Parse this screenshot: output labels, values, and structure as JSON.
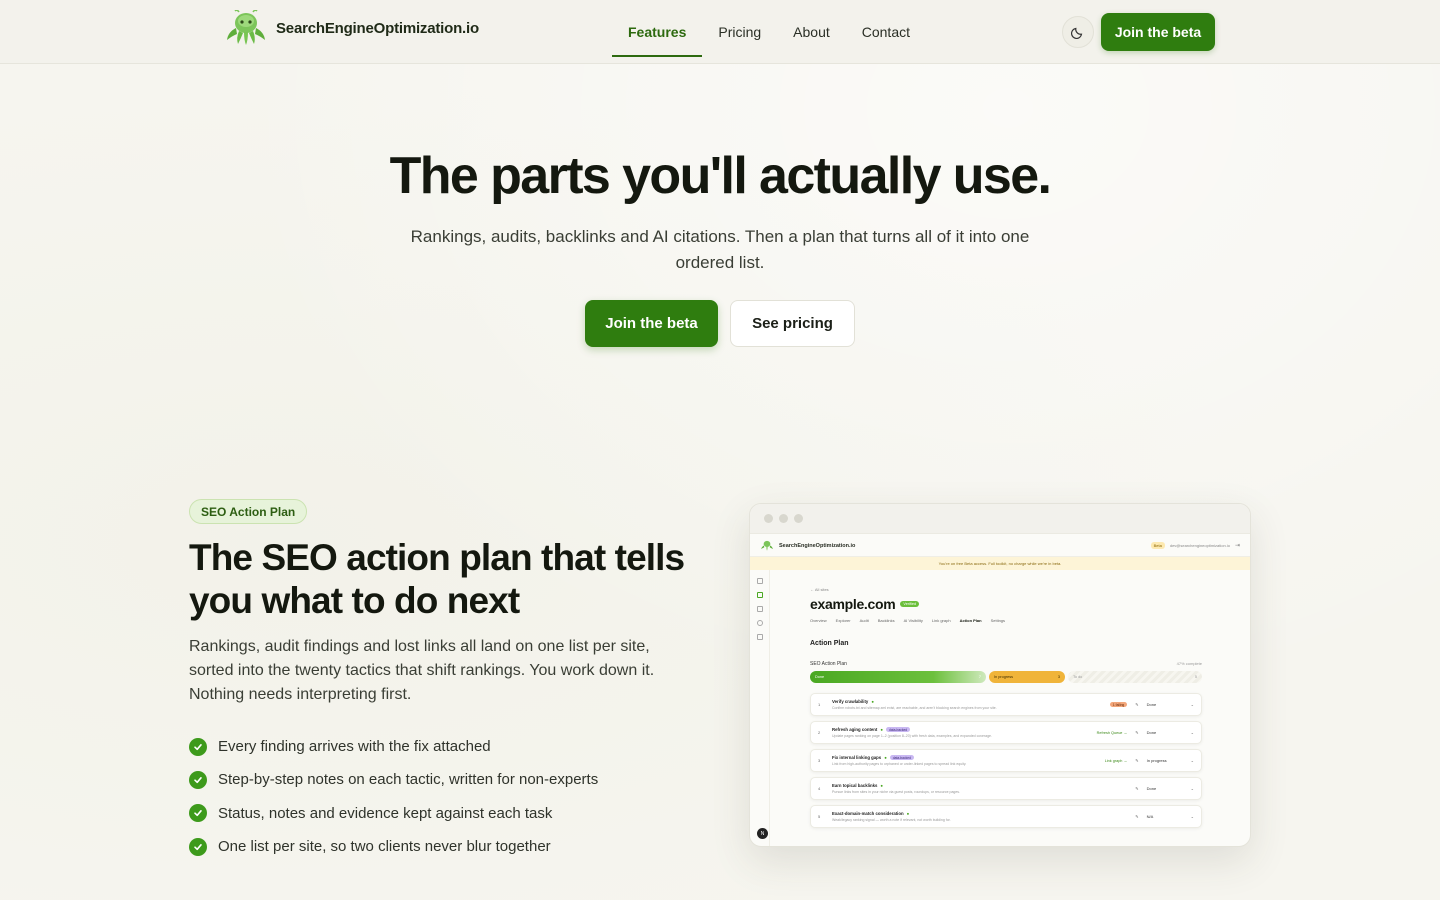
{
  "nav": {
    "brand": "SearchEngineOptimization.io",
    "links": [
      {
        "label": "Features",
        "active": true
      },
      {
        "label": "Pricing",
        "active": false
      },
      {
        "label": "About",
        "active": false
      },
      {
        "label": "Contact",
        "active": false
      }
    ],
    "theme_icon": "moon-icon",
    "cta": "Join the beta"
  },
  "hero": {
    "title": "The parts you'll actually use.",
    "subtitle": "Rankings, audits, backlinks and AI citations. Then a plan that turns all of it into one ordered list.",
    "primary_cta": "Join the beta",
    "secondary_cta": "See pricing"
  },
  "feature": {
    "badge": "SEO Action Plan",
    "title": "The SEO action plan that tells you what to do next",
    "description": "Rankings, audit findings and lost links all land on one list per site, sorted into the twenty tactics that shift rankings. You work down it. Nothing needs interpreting first.",
    "bullets": [
      "Every finding arrives with the fix attached",
      "Step-by-step notes on each tactic, written for non-experts",
      "Status, notes and evidence kept against each task",
      "One list per site, so two clients never blur together"
    ]
  },
  "mockup": {
    "brand": "SearchEngineOptimization.io",
    "beta_tag": "Beta",
    "email": "dev@searchengineoptimization.io",
    "banner": "You're on free Beta access. Full toolkit, no charge while we're in beta.",
    "back_link": "← All sites",
    "domain": "example.com",
    "verified": "Verified",
    "tabs": [
      "Overview",
      "Explorer",
      "Audit",
      "Backlinks",
      "AI Visibility",
      "Link graph",
      "Action Plan",
      "Settings"
    ],
    "active_tab": "Action Plan",
    "section_title": "Action Plan",
    "plan_title": "SEO Action Plan",
    "percent_complete": "47% complete",
    "progress": {
      "done_label": "Done",
      "done_count": "7",
      "in_progress_label": "In progress",
      "in_progress_count": "3",
      "todo_label": "To do",
      "todo_count": "5"
    },
    "tasks": [
      {
        "num": "1",
        "title": "Verify crawlability",
        "desc": "Confirm robots.txt and sitemap.xml exist, are reachable, and aren't blocking search engines from your site.",
        "tag": "1 failing",
        "link": "",
        "status": "Done"
      },
      {
        "num": "2",
        "title": "Refresh aging content",
        "desc": "Update pages ranking on page 1–2 (position 8–20) with fresh data, examples, and expanded coverage.",
        "tag": "data-backed",
        "link": "Refresh Queue →",
        "status": "Done"
      },
      {
        "num": "3",
        "title": "Fix internal linking gaps",
        "desc": "Link from high-authority pages to orphaned or under-linked pages to spread link equity.",
        "tag": "data-backed",
        "link": "Link graph →",
        "status": "In progress"
      },
      {
        "num": "4",
        "title": "Earn topical backlinks",
        "desc": "Pursue links from sites in your niche via guest posts, roundups, or resource pages.",
        "tag": "",
        "link": "",
        "status": "Done"
      },
      {
        "num": "5",
        "title": "Exact-domain-match consideration",
        "desc": "Weak/legacy ranking signal — worth a note if relevant, not worth building for.",
        "tag": "",
        "link": "",
        "status": "N/A"
      }
    ]
  },
  "colors": {
    "brand_green": "#2f7d0f",
    "check_green": "#3d9a1b",
    "background": "#f6f5ef"
  }
}
